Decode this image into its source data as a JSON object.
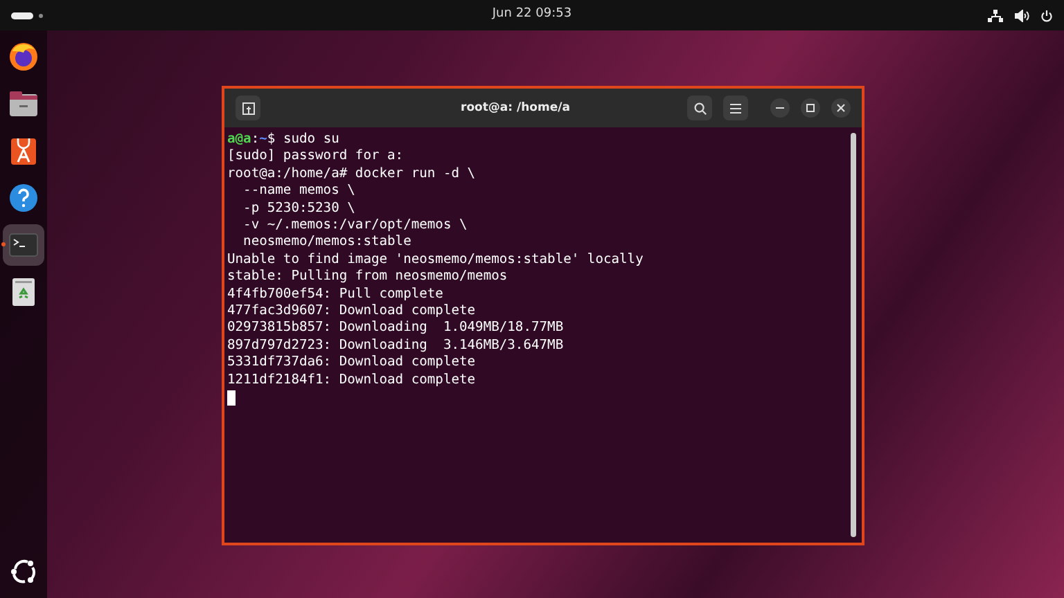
{
  "top_bar": {
    "clock": "Jun 22  09:53"
  },
  "dock": {
    "items": [
      {
        "kind": "browser",
        "running": false
      },
      {
        "kind": "files",
        "running": false
      },
      {
        "kind": "store",
        "running": false
      },
      {
        "kind": "help",
        "running": false
      },
      {
        "kind": "terminal",
        "running": true
      },
      {
        "kind": "trash",
        "running": false
      }
    ]
  },
  "terminal": {
    "title": "root@a: /home/a",
    "lines": [
      {
        "kind": "prompt",
        "user_host": "a@a",
        "separator": ":",
        "path": "~",
        "command": "$ sudo su"
      },
      {
        "kind": "output",
        "text": "[sudo] password for a:"
      },
      {
        "kind": "output",
        "text": "root@a:/home/a# docker run -d \\"
      },
      {
        "kind": "output",
        "text": "  --name memos \\"
      },
      {
        "kind": "output",
        "text": "  -p 5230:5230 \\"
      },
      {
        "kind": "output",
        "text": "  -v ~/.memos:/var/opt/memos \\"
      },
      {
        "kind": "output",
        "text": "  neosmemo/memos:stable"
      },
      {
        "kind": "output",
        "text": "Unable to find image 'neosmemo/memos:stable' locally"
      },
      {
        "kind": "output",
        "text": "stable: Pulling from neosmemo/memos"
      },
      {
        "kind": "output",
        "text": "4f4fb700ef54: Pull complete"
      },
      {
        "kind": "output",
        "text": "477fac3d9607: Download complete"
      },
      {
        "kind": "output",
        "text": "02973815b857: Downloading  1.049MB/18.77MB"
      },
      {
        "kind": "output",
        "text": "897d797d2723: Downloading  3.146MB/3.647MB"
      },
      {
        "kind": "output",
        "text": "5331df737da6: Download complete"
      },
      {
        "kind": "output",
        "text": "1211df2184f1: Download complete"
      },
      {
        "kind": "cursor"
      }
    ]
  }
}
